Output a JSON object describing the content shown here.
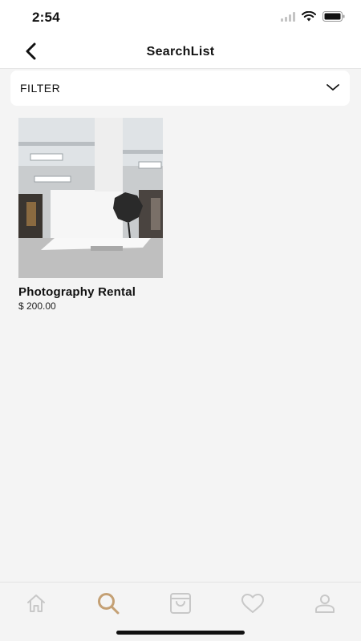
{
  "status_bar": {
    "time": "2:54"
  },
  "header": {
    "title": "SearchList",
    "back_icon": "chevron-left-icon"
  },
  "filter": {
    "label": "FILTER",
    "icon": "chevron-down-icon"
  },
  "products": [
    {
      "name": "Photography Rental",
      "price": "$ 200.00",
      "image": "photo-studio-image"
    }
  ],
  "tab_bar": {
    "tabs": [
      {
        "icon": "home-icon",
        "active": false
      },
      {
        "icon": "search-icon",
        "active": true
      },
      {
        "icon": "shopping-bag-icon",
        "active": false
      },
      {
        "icon": "heart-icon",
        "active": false
      },
      {
        "icon": "user-icon",
        "active": false
      }
    ],
    "active_color": "#c4a074",
    "inactive_color": "#c8c8c8"
  }
}
